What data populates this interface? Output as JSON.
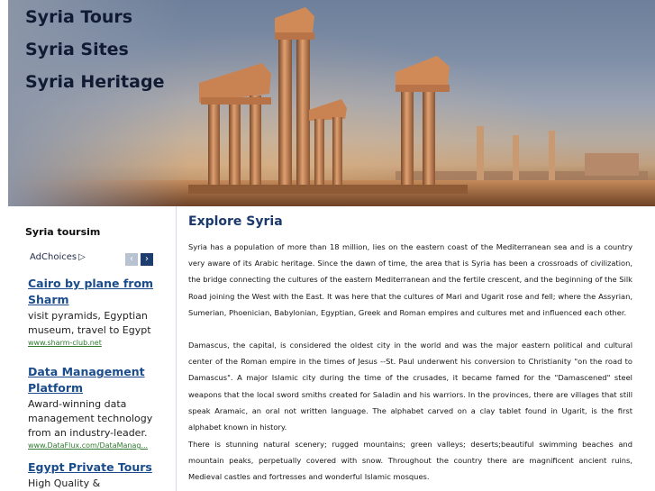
{
  "header": {
    "links": [
      "Syria Tours",
      "Syria Sites",
      "Syria Heritage"
    ]
  },
  "sidebar": {
    "title": "Syria toursim",
    "adchoices": "AdChoices",
    "ads": [
      {
        "title": "Cairo by plane from Sharm",
        "text": "visit pyramids, Egyptian museum, travel to Egypt",
        "url": "www.sharm-club.net"
      },
      {
        "title": "Data Management Platform",
        "text": "Award-winning data management technology from an industry-leader.",
        "url": "www.DataFlux.com/DataManag..."
      },
      {
        "title": "Egypt Private Tours",
        "text": "High Quality &",
        "url": ""
      }
    ]
  },
  "main": {
    "title": "Explore Syria",
    "paragraphs": [
      "Syria has a population of more than 18 million, lies on the eastern coast of the Mediterranean sea and is a country very aware of its Arabic heritage. Since the dawn of time, the area that is Syria has been a crossroads of civilization, the bridge connecting the cultures of the eastern Mediterranean and the fertile crescent, and the beginning of the Silk Road joining the West with the East. It was here that the cultures of Mari and Ugarit rose and fell; where the Assyrian, Sumerian, Phoenician, Babylonian, Egyptian, Greek and Roman empires and cultures met and influenced each other.",
      "Damascus, the capital, is considered the oldest city in the world and was the major eastern political and cultural center of the Roman empire in the times of Jesus --St. Paul underwent his conversion to Christianity \"on the road to Damascus\". A major Islamic city during the time of the crusades, it became famed for the \"Damascened\" steel weapons that the local sword smiths created for Saladin and his warriors. In the provinces, there are villages that still speak Aramaic, an oral not written language. The alphabet carved on a clay tablet found in Ugarit, is the first alphabet known in history.",
      "There is stunning natural scenery; rugged mountains; green valleys; deserts;beautiful swimming beaches and mountain peaks, perpetually covered with snow. Throughout the country there are magnificent ancient ruins, Medieval castles and fortresses and wonderful Islamic mosques."
    ]
  }
}
